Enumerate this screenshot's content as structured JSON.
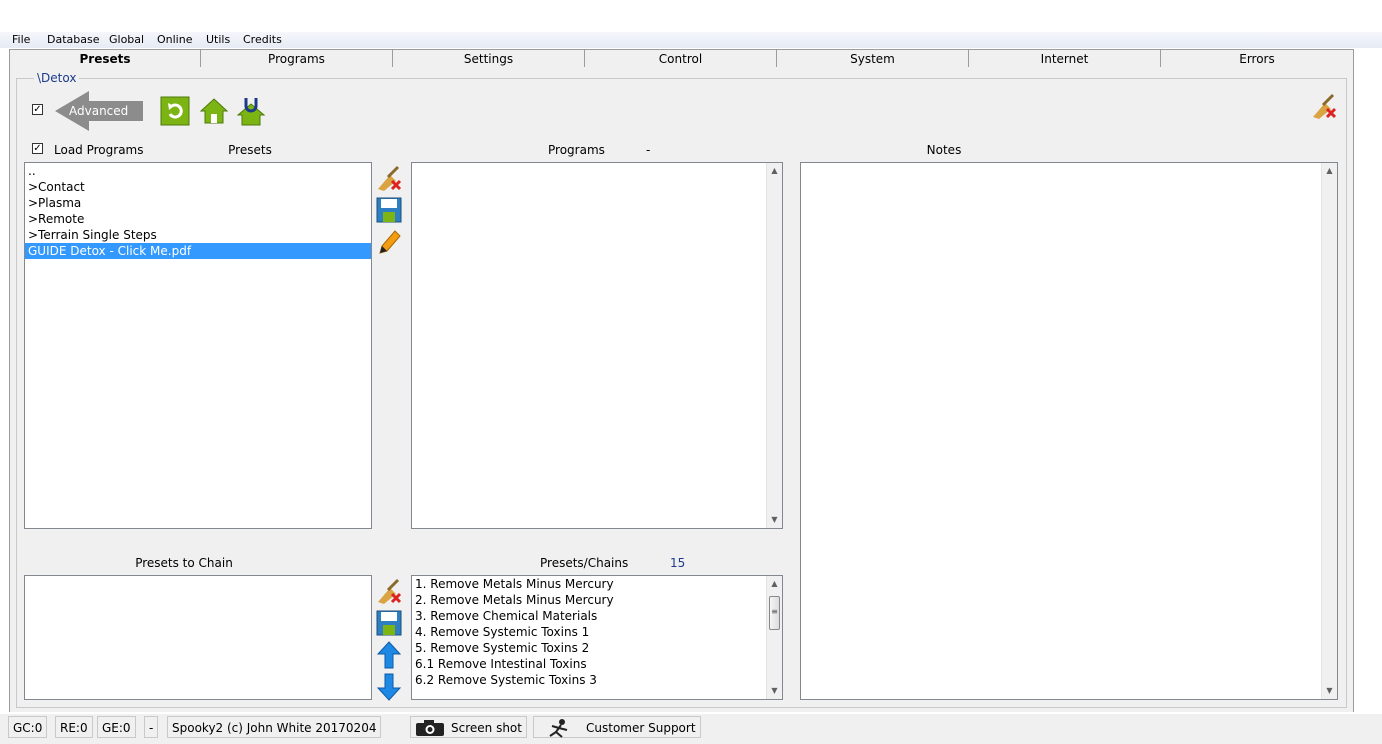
{
  "menu": [
    "File",
    "Database",
    "Global",
    "Online",
    "Utils",
    "Credits"
  ],
  "tabs": [
    "Presets",
    "Programs",
    "Settings",
    "Control",
    "System",
    "Internet",
    "Errors"
  ],
  "active_tab": "Presets",
  "group_label": "\\Detox",
  "advanced": {
    "label": "Advanced",
    "checked": true
  },
  "load_programs": {
    "label": "Load Programs",
    "checked": true
  },
  "headers": {
    "presets": "Presets",
    "programs": "Programs",
    "programs_count": "-",
    "notes": "Notes",
    "presets_to_chain": "Presets to Chain",
    "presets_chains": "Presets/Chains",
    "presets_chains_count": "15"
  },
  "presets_list": [
    "..",
    ">Contact",
    ">Plasma",
    ">Remote",
    ">Terrain Single Steps",
    "GUIDE Detox - Click Me.pdf"
  ],
  "presets_selected_index": 5,
  "presets_chains_list": [
    "1. Remove Metals Minus Mercury",
    "2. Remove Metals Minus Mercury",
    "3. Remove Chemical Materials",
    "4. Remove Systemic Toxins 1",
    "5. Remove Systemic Toxins 2",
    "6.1 Remove Intestinal Toxins",
    "6.2 Remove Systemic Toxins 3"
  ],
  "status": {
    "gc": "GC:0",
    "re": "RE:0",
    "ge": "GE:0",
    "dash": "-",
    "copyright": "Spooky2 (c) John White 20170204",
    "screenshot": "Screen shot",
    "support": "Customer Support"
  },
  "colors": {
    "accent_green": "#7cb414",
    "selection": "#3399ff",
    "label_blue": "#1b3b8a"
  }
}
